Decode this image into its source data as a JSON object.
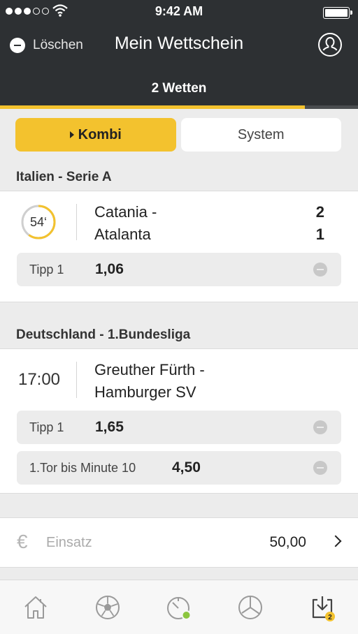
{
  "status_bar": {
    "time": "9:42 AM"
  },
  "header": {
    "clear_label": "Löschen",
    "title": "Mein Wettschein",
    "tab_label": "2 Wetten"
  },
  "segment": {
    "kombi": "Kombi",
    "system": "System",
    "selected": "Kombi"
  },
  "sections": [
    {
      "league": "Italien - Serie A",
      "match": {
        "minute": "54‘",
        "progress_fraction": 0.6,
        "home": "Catania -",
        "away": "Atalanta",
        "score_home": "2",
        "score_away": "1"
      },
      "tips": [
        {
          "label": "Tipp 1",
          "odd": "1,06"
        }
      ]
    },
    {
      "league": "Deutschland - 1.Bundesliga",
      "match": {
        "kickoff": "17:00",
        "home": "Greuther Fürth -",
        "away": "Hamburger SV"
      },
      "tips": [
        {
          "label": "Tipp 1",
          "odd": "1,65"
        },
        {
          "label": "1.Tor bis Minute 10",
          "odd": "4,50"
        }
      ]
    }
  ],
  "stake": {
    "currency_symbol": "€",
    "label": "Einsatz",
    "value": "50,00"
  },
  "bottom_nav": {
    "items": [
      "home-icon",
      "football-icon",
      "live-timer-icon",
      "statistics-icon",
      "betslip-icon"
    ],
    "betslip_badge": "2"
  },
  "colors": {
    "header_bg": "#2d3033",
    "accent": "#f3c22e",
    "live_dot": "#8cc63f"
  }
}
